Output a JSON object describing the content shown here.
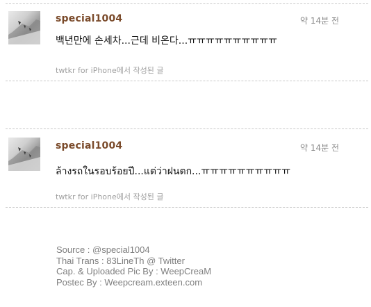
{
  "tweets": [
    {
      "username": "special1004",
      "timestamp": "약 14분 전",
      "text": "백년만에 손세차...근데 비온다...ㅠㅠㅠㅠㅠㅠㅠㅠㅠㅠ",
      "source": "twtkr for iPhone에서 작성된 글"
    },
    {
      "username": "special1004",
      "timestamp": "약 14분 전",
      "text": " ล้างรถในรอบร้อยปี...แต่ว่าฝนตก...ㅠㅠㅠㅠㅠㅠㅠㅠㅠㅠ",
      "source": "twtkr for iPhone에서 작성된 글"
    }
  ],
  "credits": [
    "Source : @special1004",
    "Thai Trans : 83LineTh @ Twitter",
    "Cap. & Uploaded Pic By : WeepCreaM",
    "Postec By : Weepcream.exteen.com"
  ]
}
